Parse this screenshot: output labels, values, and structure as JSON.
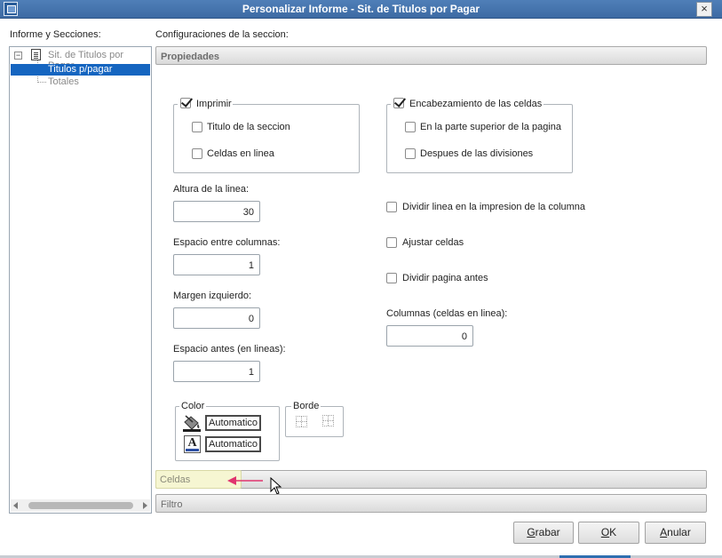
{
  "window": {
    "title": "Personalizar Informe - Sit. de Titulos por Pagar",
    "close_label": "×"
  },
  "left_panel": {
    "header": "Informe y Secciones:",
    "tree": {
      "expander": "−",
      "root": "Sit. de Titulos por Pagar",
      "children": [
        "Titulos p/pagar",
        "Totales"
      ],
      "selected_index": 0
    }
  },
  "right_panel": {
    "header": "Configuraciones de la seccion:",
    "sections": {
      "propiedades": "Propiedades",
      "celdas": "Celdas",
      "filtro": "Filtro"
    }
  },
  "properties": {
    "imprimir": {
      "label": "Imprimir",
      "checked": true
    },
    "titulo_seccion": {
      "label": "Titulo de la seccion",
      "checked": false
    },
    "celdas_en_linea": {
      "label": "Celdas en linea",
      "checked": false
    },
    "encabezamiento": {
      "label": "Encabezamiento de las celdas",
      "checked": true
    },
    "parte_superior": {
      "label": "En la parte superior de la pagina",
      "checked": false
    },
    "despues_divisiones": {
      "label": "Despues de las divisiones",
      "checked": false
    },
    "altura_linea": {
      "label": "Altura de la linea:",
      "value": "30"
    },
    "espacio_columnas": {
      "label": "Espacio entre columnas:",
      "value": "1"
    },
    "margen_izquierdo": {
      "label": "Margen izquierdo:",
      "value": "0"
    },
    "espacio_antes": {
      "label": "Espacio antes (en lineas):",
      "value": "1"
    },
    "dividir_linea": {
      "label": "Dividir linea en la impresion de la columna",
      "checked": false
    },
    "ajustar_celdas": {
      "label": "Ajustar celdas",
      "checked": false
    },
    "dividir_pagina": {
      "label": "Dividir pagina antes",
      "checked": false
    },
    "columnas": {
      "label": "Columnas (celdas en linea):",
      "value": "0"
    },
    "color": {
      "label": "Color",
      "fill_value": "Automatico",
      "font_value": "Automatico",
      "font_icon_letter": "A"
    },
    "borde": {
      "label": "Borde"
    }
  },
  "buttons": {
    "grabar": "Grabar",
    "ok": "OK",
    "anular": "Anular"
  },
  "colors": {
    "titlebar": "#4f7fb8",
    "selection": "#1565c0",
    "pointer_arrow": "#e0356e"
  }
}
